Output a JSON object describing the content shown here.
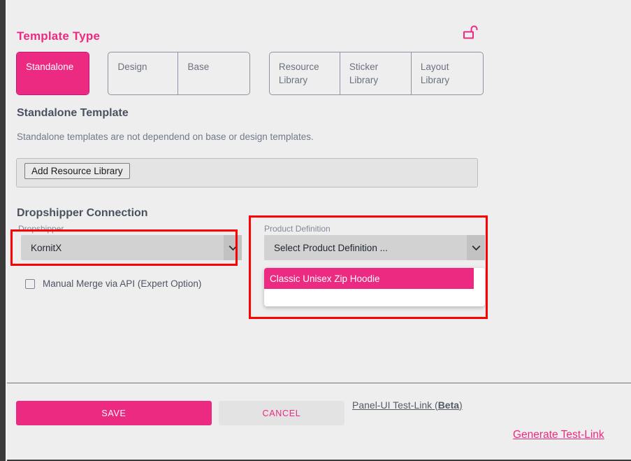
{
  "colors": {
    "accent_pink": "#ec2a82",
    "panel_bg": "#eeeeee",
    "annotation_red": "#fe0000",
    "select_bg": "#d2d2d2",
    "text_dark": "#4a5260",
    "text_muted": "#73798a"
  },
  "template_type": {
    "title": "Template Type",
    "lock_icon": "unlock-icon",
    "groups": [
      {
        "options": [
          {
            "label": "Standalone",
            "selected": true
          }
        ]
      },
      {
        "options": [
          {
            "label": "Design",
            "selected": false
          },
          {
            "label": "Base",
            "selected": false
          }
        ]
      },
      {
        "options": [
          {
            "label": "Resource\nLibrary",
            "selected": false
          },
          {
            "label": "Sticker\nLibrary",
            "selected": false
          },
          {
            "label": "Layout\nLibrary",
            "selected": false
          }
        ]
      }
    ]
  },
  "standalone": {
    "heading": "Standalone Template",
    "description": "Standalone templates are not dependend on base or design templates.",
    "add_resource_library_label": "Add Resource Library"
  },
  "dropshipper": {
    "heading": "Dropshipper Connection",
    "dropshipper_label": "Dropshipper",
    "dropshipper_value": "KornitX",
    "product_definition_label": "Product Definition",
    "product_definition_value": "Select Product Definition ...",
    "product_definition_options": [
      "Classic Unisex Zip Hoodie"
    ],
    "manual_merge_label": "Manual Merge via API (Expert Option)",
    "manual_merge_checked": false
  },
  "footer": {
    "save_label": "SAVE",
    "cancel_label": "CANCEL",
    "panel_link_prefix": "Panel-UI Test-Link (",
    "panel_link_bold": "Beta",
    "panel_link_suffix": ")",
    "generate_link_label": "Generate Test-Link"
  }
}
